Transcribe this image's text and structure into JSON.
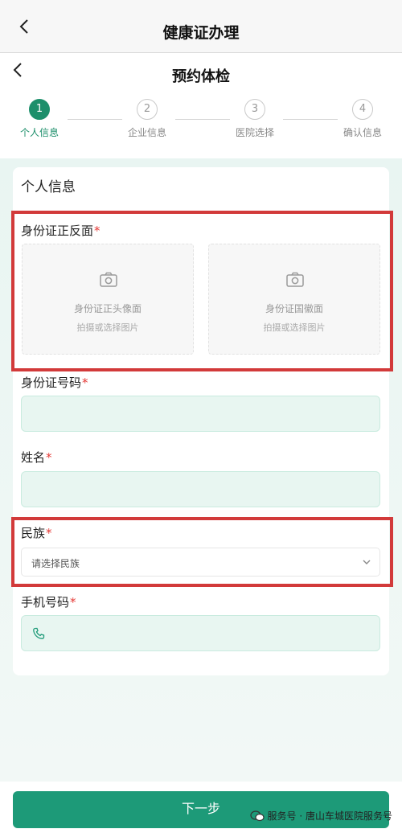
{
  "header": {
    "title": "健康证办理"
  },
  "subheader": {
    "title": "预约体检"
  },
  "steps": [
    {
      "number": "1",
      "label": "个人信息",
      "active": true
    },
    {
      "number": "2",
      "label": "企业信息",
      "active": false
    },
    {
      "number": "3",
      "label": "医院选择",
      "active": false
    },
    {
      "number": "4",
      "label": "确认信息",
      "active": false
    }
  ],
  "form": {
    "section_title": "个人信息",
    "id_photos": {
      "label": "身份证正反面",
      "required_mark": "*",
      "front": {
        "title": "身份证正头像面",
        "hint": "拍摄或选择图片"
      },
      "back": {
        "title": "身份证国徽面",
        "hint": "拍摄或选择图片"
      }
    },
    "id_number": {
      "label": "身份证号码",
      "required_mark": "*",
      "value": ""
    },
    "name": {
      "label": "姓名",
      "required_mark": "*",
      "value": ""
    },
    "ethnicity": {
      "label": "民族",
      "required_mark": "*",
      "placeholder": "请选择民族"
    },
    "phone": {
      "label": "手机号码",
      "required_mark": "*",
      "value": ""
    }
  },
  "footer": {
    "next_label": "下一步"
  },
  "watermark": {
    "text": "服务号 · 唐山车城医院服务号"
  },
  "colors": {
    "accent": "#1d9a78",
    "highlight": "#d23a3a",
    "input_bg": "#e8f6f1"
  }
}
